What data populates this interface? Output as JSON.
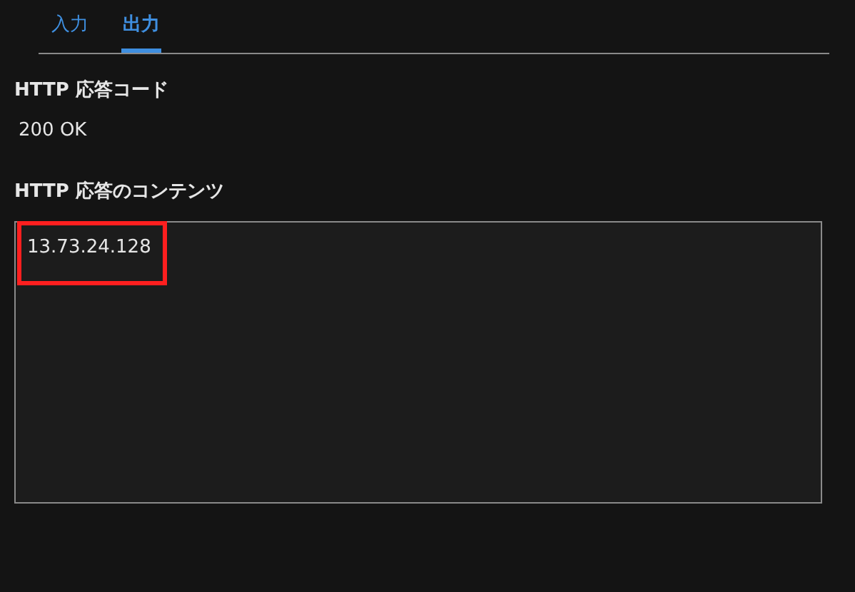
{
  "tabs": [
    {
      "label": "入力",
      "selected": false
    },
    {
      "label": "出力",
      "selected": true
    }
  ],
  "fields": [
    {
      "kind": "text",
      "label": "HTTP 応答コード",
      "value": "200 OK"
    },
    {
      "kind": "textarea",
      "label": "HTTP 応答のコンテンツ",
      "value": "13.73.24.128",
      "highlighted": true
    }
  ]
}
